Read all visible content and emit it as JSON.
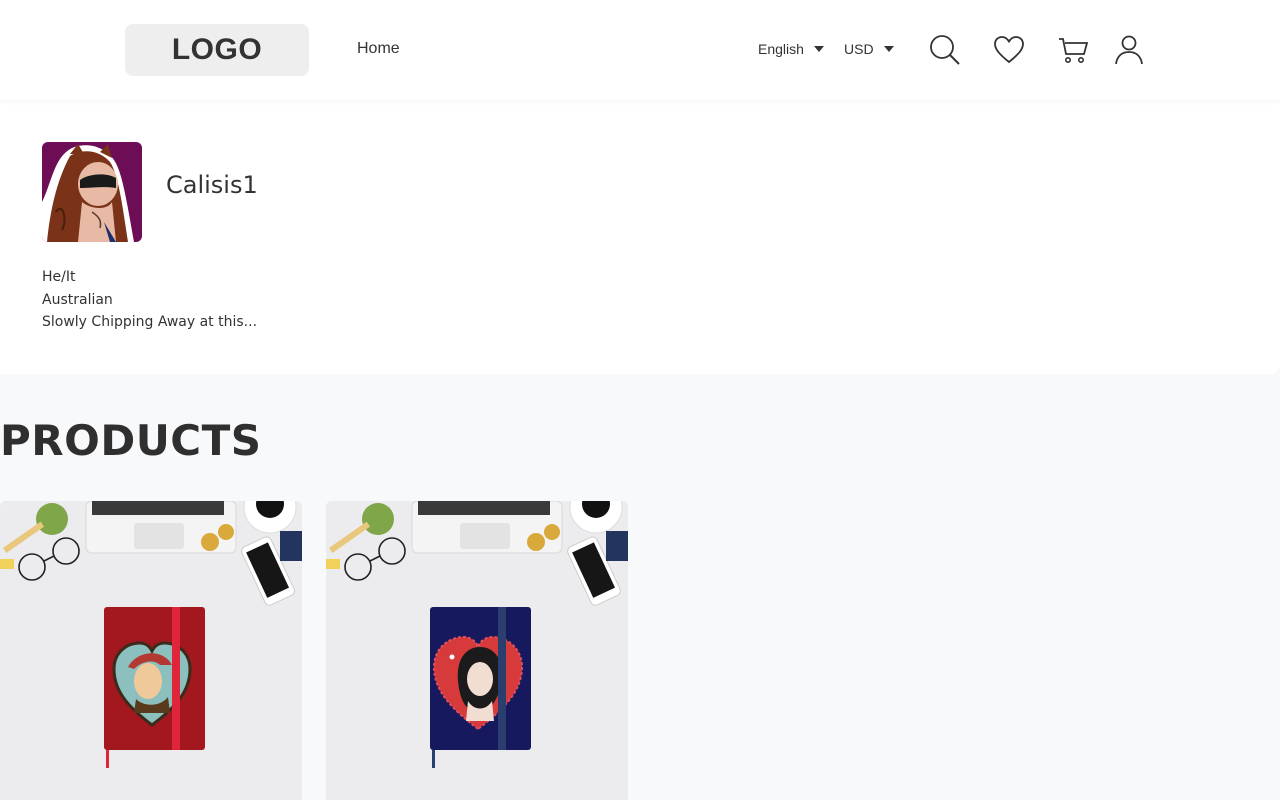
{
  "header": {
    "logo_text": "LOGO",
    "nav_home": "Home",
    "language": "English",
    "currency": "USD",
    "icons": [
      "search-icon",
      "heart-icon",
      "cart-icon",
      "user-icon"
    ]
  },
  "profile": {
    "name": "Calisis1",
    "bio_lines": [
      "He/It",
      "Australian",
      "Slowly Chipping Away at this..."
    ]
  },
  "products": {
    "title": "PRODUCTS",
    "items": [
      {
        "notebook_color": "#a3171e",
        "strap_color": "#e0253a",
        "portrait": "man-with-cap-in-heart"
      },
      {
        "notebook_color": "#16195e",
        "strap_color": "#2a3f6e",
        "portrait": "woman-winking-in-heart"
      }
    ]
  },
  "colors": {
    "page_bg": "#f8f9fb",
    "header_bg": "#ffffff",
    "logo_bg": "#eeeeee",
    "text": "#333333"
  }
}
